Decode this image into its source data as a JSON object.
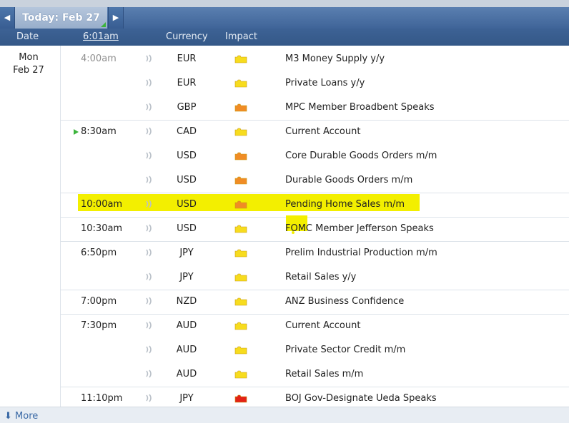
{
  "nav": {
    "prev_icon": "◀",
    "next_icon": "▶",
    "today_label": "Today: Feb 27"
  },
  "header": {
    "date": "Date",
    "time": "6:01am",
    "currency": "Currency",
    "impact": "Impact"
  },
  "day": {
    "weekday": "Mon",
    "date": "Feb 27"
  },
  "colors": {
    "yellow_impact": "#f7dc1e",
    "orange_impact": "#f08c25",
    "red_impact": "#e32116",
    "highlight": "#f3ef00",
    "arrow": "#3cb43c"
  },
  "events": [
    {
      "time": "4:00am",
      "currency": "EUR",
      "impact": "yellow",
      "event": "M3 Money Supply y/y"
    },
    {
      "time": "",
      "currency": "EUR",
      "impact": "yellow",
      "event": "Private Loans y/y"
    },
    {
      "time": "",
      "currency": "GBP",
      "impact": "orange",
      "event": "MPC Member Broadbent Speaks"
    },
    {
      "time": "8:30am",
      "currency": "CAD",
      "impact": "yellow",
      "event": "Current Account"
    },
    {
      "time": "",
      "currency": "USD",
      "impact": "orange",
      "event": "Core Durable Goods Orders m/m"
    },
    {
      "time": "",
      "currency": "USD",
      "impact": "orange",
      "event": "Durable Goods Orders m/m"
    },
    {
      "time": "10:00am",
      "currency": "USD",
      "impact": "orange",
      "event": "Pending Home Sales m/m"
    },
    {
      "time": "10:30am",
      "currency": "USD",
      "impact": "yellow",
      "event": "FOMC Member Jefferson Speaks"
    },
    {
      "time": "6:50pm",
      "currency": "JPY",
      "impact": "yellow",
      "event": "Prelim Industrial Production m/m"
    },
    {
      "time": "",
      "currency": "JPY",
      "impact": "yellow",
      "event": "Retail Sales y/y"
    },
    {
      "time": "7:00pm",
      "currency": "NZD",
      "impact": "yellow",
      "event": "ANZ Business Confidence"
    },
    {
      "time": "7:30pm",
      "currency": "AUD",
      "impact": "yellow",
      "event": "Current Account"
    },
    {
      "time": "",
      "currency": "AUD",
      "impact": "yellow",
      "event": "Private Sector Credit m/m"
    },
    {
      "time": "",
      "currency": "AUD",
      "impact": "yellow",
      "event": "Retail Sales m/m"
    },
    {
      "time": "11:10pm",
      "currency": "JPY",
      "impact": "red",
      "event": "BOJ Gov-Designate Ueda Speaks"
    }
  ],
  "footer": {
    "more_icon": "⬇",
    "more_label": "More"
  }
}
